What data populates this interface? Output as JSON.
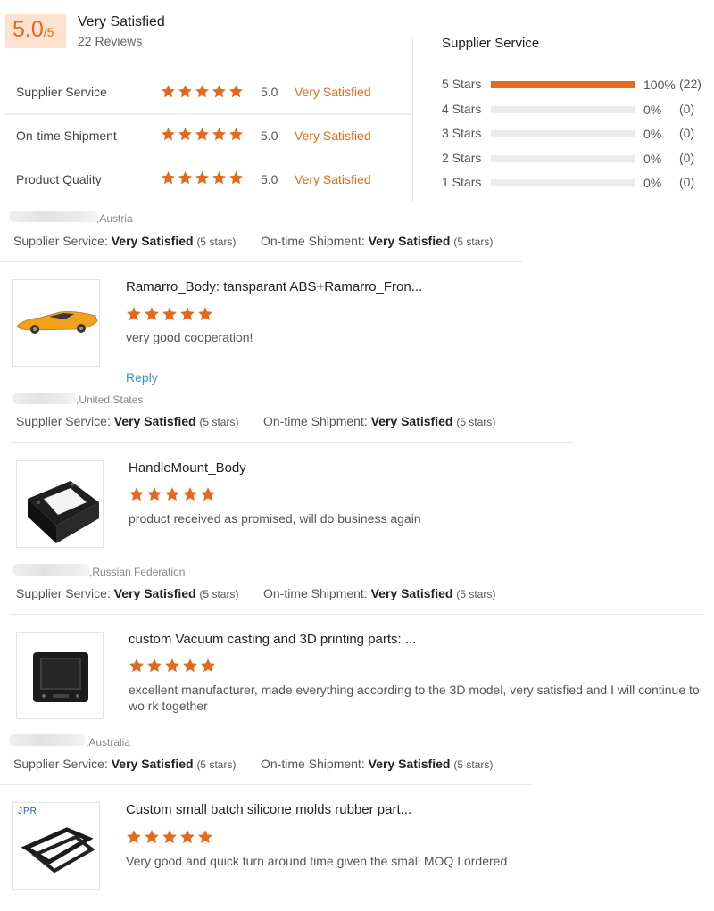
{
  "summary": {
    "score": "5.0",
    "score_denominator": "/5",
    "label": "Very Satisfied",
    "review_count": "22 Reviews",
    "accent_color": "#e36a1c"
  },
  "ratings": [
    {
      "label": "Supplier Service",
      "score": "5.0",
      "word": "Very Satisfied",
      "stars": 5
    },
    {
      "label": "On-time Shipment",
      "score": "5.0",
      "word": "Very Satisfied",
      "stars": 5
    },
    {
      "label": "Product Quality",
      "score": "5.0",
      "word": "Very Satisfied",
      "stars": 5
    }
  ],
  "distribution": {
    "title": "Supplier Service",
    "rows": [
      {
        "label": "5 Stars",
        "fraction": 1.0,
        "pct": "100%",
        "count": "(22)"
      },
      {
        "label": "4 Stars",
        "fraction": 0,
        "pct": "0%",
        "count": "(0)"
      },
      {
        "label": "3 Stars",
        "fraction": 0,
        "pct": "0%",
        "count": "(0)"
      },
      {
        "label": "2 Stars",
        "fraction": 0,
        "pct": "0%",
        "count": "(0)"
      },
      {
        "label": "1 Stars",
        "fraction": 0,
        "pct": "0%",
        "count": "(0)"
      }
    ]
  },
  "meta_labels": {
    "supplier_service": "Supplier Service:",
    "ontime_shipment": "On-time Shipment:"
  },
  "reviews": [
    {
      "country": ",Austria",
      "supplier_service": "Very Satisfied",
      "supplier_stars": "(5 stars)",
      "shipment": "Very Satisfied",
      "shipment_stars": "(5 stars)",
      "product_title": "Ramarro_Body: tansparant ABS+Ramarro_Fron...",
      "product_stars": 5,
      "comment": "very good cooperation!",
      "reply": "Reply",
      "thumb_icon": "yellow-sports-car-icon"
    },
    {
      "country": ",United States",
      "supplier_service": "Very Satisfied",
      "supplier_stars": "(5 stars)",
      "shipment": "Very Satisfied",
      "shipment_stars": "(5 stars)",
      "product_title": "HandleMount_Body",
      "product_stars": 5,
      "comment": "product received as promised, will do business again",
      "thumb_icon": "black-handle-mount-icon"
    },
    {
      "country": ",Russian Federation",
      "supplier_service": "Very Satisfied",
      "supplier_stars": "(5 stars)",
      "shipment": "Very Satisfied",
      "shipment_stars": "(5 stars)",
      "product_title": "custom Vacuum casting and 3D printing parts: ...",
      "product_stars": 5,
      "comment": "excellent manufacturer, made everything according to the 3D model, very satisfied and I will continue to wo rk together",
      "thumb_icon": "black-device-housing-icon"
    },
    {
      "country": ",Australia",
      "supplier_service": "Very Satisfied",
      "supplier_stars": "(5 stars)",
      "shipment": "Very Satisfied",
      "shipment_stars": "(5 stars)",
      "product_title": "Custom small batch silicone molds rubber part...",
      "product_stars": 5,
      "comment": "Very good and quick turn around time given the small MOQ I ordered",
      "thumb_logo": "JPR",
      "thumb_icon": "silicone-rubber-frame-icon"
    }
  ]
}
